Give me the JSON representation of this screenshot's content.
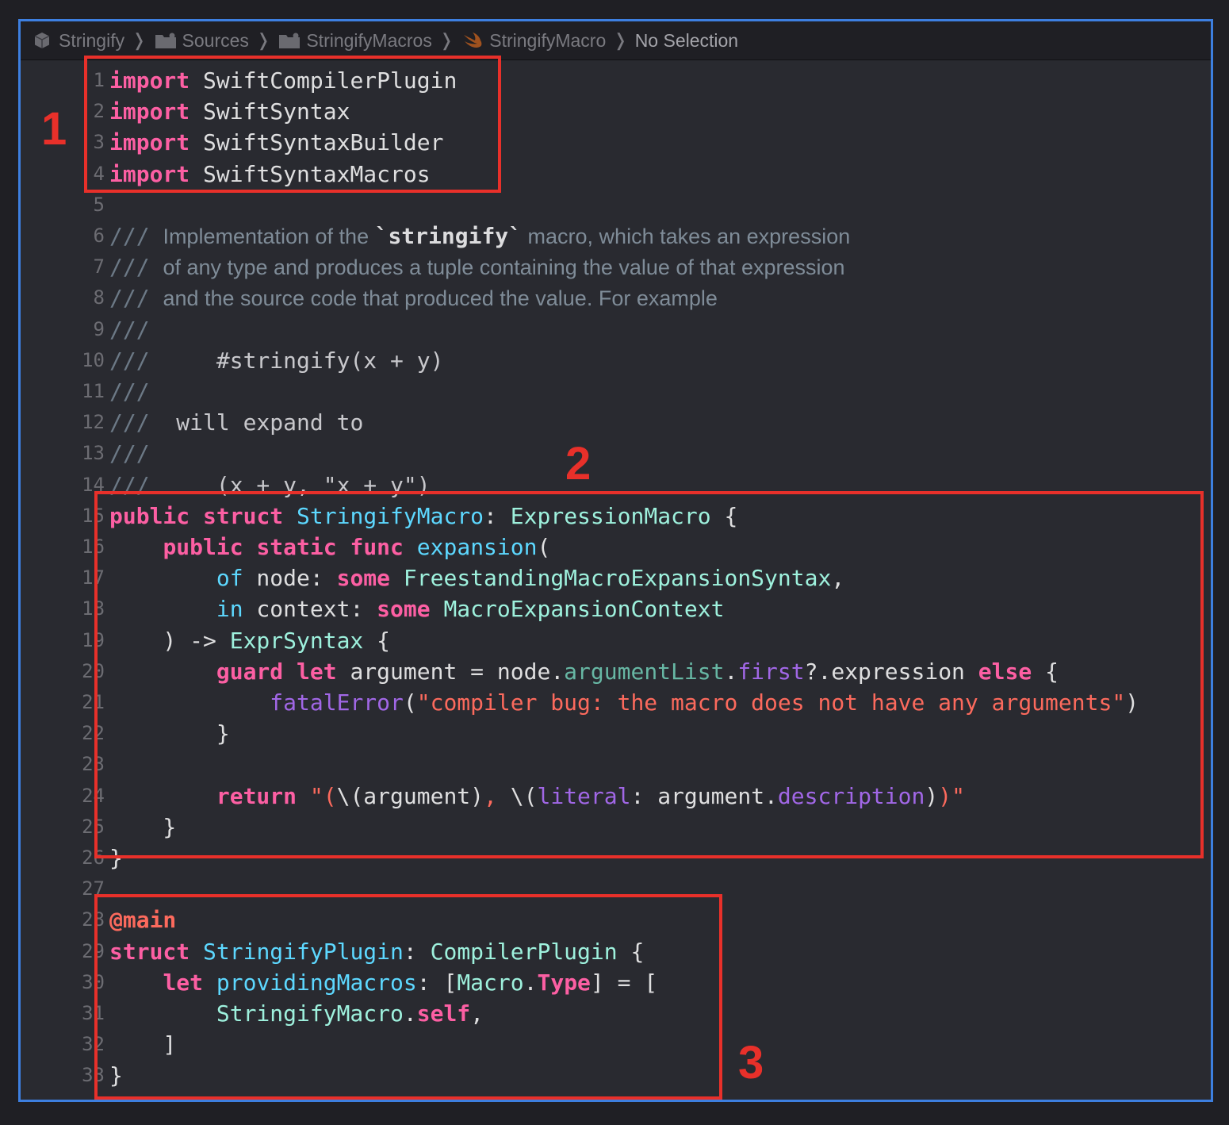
{
  "jumpbar": {
    "items": [
      {
        "label": "Stringify",
        "icon": "package-icon"
      },
      {
        "label": "Sources",
        "icon": "folder-icon"
      },
      {
        "label": "StringifyMacros",
        "icon": "folder-icon"
      },
      {
        "label": "StringifyMacro",
        "icon": "swift-icon"
      },
      {
        "label": "No Selection",
        "icon": ""
      }
    ],
    "separator": "❭"
  },
  "editor": {
    "line_numbers": [
      "1",
      "2",
      "3",
      "4",
      "5",
      "6",
      "7",
      "8",
      "9",
      "10",
      "11",
      "12",
      "13",
      "14",
      "15",
      "16",
      "17",
      "18",
      "19",
      "20",
      "21",
      "22",
      "23",
      "24",
      "25",
      "26",
      "27",
      "28",
      "29",
      "30",
      "31",
      "32",
      "33"
    ],
    "lines": [
      [
        {
          "t": "kw",
          "v": "import"
        },
        {
          "t": "plain",
          "v": " SwiftCompilerPlugin"
        }
      ],
      [
        {
          "t": "kw",
          "v": "import"
        },
        {
          "t": "plain",
          "v": " SwiftSyntax"
        }
      ],
      [
        {
          "t": "kw",
          "v": "import"
        },
        {
          "t": "plain",
          "v": " SwiftSyntaxBuilder"
        }
      ],
      [
        {
          "t": "kw",
          "v": "import"
        },
        {
          "t": "plain",
          "v": " SwiftSyntaxMacros"
        }
      ],
      [],
      [
        {
          "t": "cmt",
          "v": "/// "
        },
        {
          "t": "cmt-text",
          "v": "Implementation of the "
        },
        {
          "t": "cmt-code-bold",
          "v": "`stringify`"
        },
        {
          "t": "cmt-text",
          "v": " macro, which takes an expression"
        }
      ],
      [
        {
          "t": "cmt",
          "v": "/// "
        },
        {
          "t": "cmt-text",
          "v": "of any type and produces a tuple containing the value of that expression"
        }
      ],
      [
        {
          "t": "cmt",
          "v": "/// "
        },
        {
          "t": "cmt-text",
          "v": "and the source code that produced the value. For example"
        }
      ],
      [
        {
          "t": "cmt",
          "v": "///"
        }
      ],
      [
        {
          "t": "cmt",
          "v": "///     "
        },
        {
          "t": "cmt-code",
          "v": "#stringify(x + y)"
        }
      ],
      [
        {
          "t": "cmt",
          "v": "///"
        }
      ],
      [
        {
          "t": "cmt",
          "v": "///  "
        },
        {
          "t": "cmt-code",
          "v": "will expand to"
        }
      ],
      [
        {
          "t": "cmt",
          "v": "///"
        }
      ],
      [
        {
          "t": "cmt",
          "v": "///     "
        },
        {
          "t": "cmt-code",
          "v": "(x + y, \"x + y\")"
        }
      ],
      [
        {
          "t": "kw",
          "v": "public"
        },
        {
          "t": "plain",
          "v": " "
        },
        {
          "t": "kw",
          "v": "struct"
        },
        {
          "t": "plain",
          "v": " "
        },
        {
          "t": "decl",
          "v": "StringifyMacro"
        },
        {
          "t": "plain",
          "v": ": "
        },
        {
          "t": "type",
          "v": "ExpressionMacro"
        },
        {
          "t": "plain",
          "v": " {"
        }
      ],
      [
        {
          "t": "plain",
          "v": "    "
        },
        {
          "t": "kw",
          "v": "public"
        },
        {
          "t": "plain",
          "v": " "
        },
        {
          "t": "kw",
          "v": "static"
        },
        {
          "t": "plain",
          "v": " "
        },
        {
          "t": "kw",
          "v": "func"
        },
        {
          "t": "plain",
          "v": " "
        },
        {
          "t": "decl",
          "v": "expansion"
        },
        {
          "t": "plain",
          "v": "("
        }
      ],
      [
        {
          "t": "plain",
          "v": "        "
        },
        {
          "t": "decl",
          "v": "of"
        },
        {
          "t": "plain",
          "v": " node: "
        },
        {
          "t": "kw",
          "v": "some"
        },
        {
          "t": "plain",
          "v": " "
        },
        {
          "t": "type",
          "v": "FreestandingMacroExpansionSyntax"
        },
        {
          "t": "plain",
          "v": ","
        }
      ],
      [
        {
          "t": "plain",
          "v": "        "
        },
        {
          "t": "decl",
          "v": "in"
        },
        {
          "t": "plain",
          "v": " context: "
        },
        {
          "t": "kw",
          "v": "some"
        },
        {
          "t": "plain",
          "v": " "
        },
        {
          "t": "type",
          "v": "MacroExpansionContext"
        }
      ],
      [
        {
          "t": "plain",
          "v": "    ) -> "
        },
        {
          "t": "type",
          "v": "ExprSyntax"
        },
        {
          "t": "plain",
          "v": " {"
        }
      ],
      [
        {
          "t": "plain",
          "v": "        "
        },
        {
          "t": "kw",
          "v": "guard"
        },
        {
          "t": "plain",
          "v": " "
        },
        {
          "t": "kw",
          "v": "let"
        },
        {
          "t": "plain",
          "v": " argument = node."
        },
        {
          "t": "fn",
          "v": "argumentList"
        },
        {
          "t": "plain",
          "v": "."
        },
        {
          "t": "prop",
          "v": "first"
        },
        {
          "t": "plain",
          "v": "?.expression "
        },
        {
          "t": "kw",
          "v": "else"
        },
        {
          "t": "plain",
          "v": " {"
        }
      ],
      [
        {
          "t": "plain",
          "v": "            "
        },
        {
          "t": "prop",
          "v": "fatalError"
        },
        {
          "t": "plain",
          "v": "("
        },
        {
          "t": "str",
          "v": "\"compiler bug: the macro does not have any arguments\""
        },
        {
          "t": "plain",
          "v": ")"
        }
      ],
      [
        {
          "t": "plain",
          "v": "        }"
        }
      ],
      [],
      [
        {
          "t": "plain",
          "v": "        "
        },
        {
          "t": "kw",
          "v": "return"
        },
        {
          "t": "plain",
          "v": " "
        },
        {
          "t": "str",
          "v": "\"("
        },
        {
          "t": "plain",
          "v": "\\(argument)"
        },
        {
          "t": "str",
          "v": ", "
        },
        {
          "t": "plain",
          "v": "\\("
        },
        {
          "t": "prop",
          "v": "literal"
        },
        {
          "t": "plain",
          "v": ": argument."
        },
        {
          "t": "prop",
          "v": "description"
        },
        {
          "t": "plain",
          "v": ")"
        },
        {
          "t": "str",
          "v": ")\""
        }
      ],
      [
        {
          "t": "plain",
          "v": "    }"
        }
      ],
      [
        {
          "t": "plain",
          "v": "}"
        }
      ],
      [],
      [
        {
          "t": "attr",
          "v": "@main"
        }
      ],
      [
        {
          "t": "kw",
          "v": "struct"
        },
        {
          "t": "plain",
          "v": " "
        },
        {
          "t": "decl",
          "v": "StringifyPlugin"
        },
        {
          "t": "plain",
          "v": ": "
        },
        {
          "t": "type",
          "v": "CompilerPlugin"
        },
        {
          "t": "plain",
          "v": " {"
        }
      ],
      [
        {
          "t": "plain",
          "v": "    "
        },
        {
          "t": "kw",
          "v": "let"
        },
        {
          "t": "plain",
          "v": " "
        },
        {
          "t": "decl",
          "v": "providingMacros"
        },
        {
          "t": "plain",
          "v": ": ["
        },
        {
          "t": "type",
          "v": "Macro"
        },
        {
          "t": "plain",
          "v": "."
        },
        {
          "t": "kw",
          "v": "Type"
        },
        {
          "t": "plain",
          "v": "] = ["
        }
      ],
      [
        {
          "t": "plain",
          "v": "        "
        },
        {
          "t": "type",
          "v": "StringifyMacro"
        },
        {
          "t": "plain",
          "v": "."
        },
        {
          "t": "kw",
          "v": "self"
        },
        {
          "t": "plain",
          "v": ","
        }
      ],
      [
        {
          "t": "plain",
          "v": "    ]"
        }
      ],
      [
        {
          "t": "plain",
          "v": "}"
        }
      ]
    ]
  },
  "annotations": [
    {
      "label": "1",
      "color": "#e8302a"
    },
    {
      "label": "2",
      "color": "#e8302a"
    },
    {
      "label": "3",
      "color": "#e8302a"
    }
  ],
  "colors": {
    "keyword": "#fc5fa3",
    "type": "#9ef1dd",
    "declaration": "#5dd8ff",
    "string": "#fc6a5d",
    "comment": "#6c7986",
    "background": "#292a30",
    "window_border": "#3d7fe0",
    "annotation": "#e8302a"
  }
}
